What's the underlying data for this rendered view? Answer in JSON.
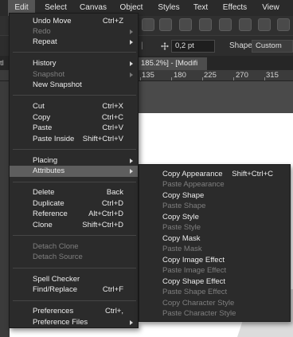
{
  "menubar": {
    "items": [
      "Edit",
      "Select",
      "Canvas",
      "Object",
      "Styles",
      "Text",
      "Effects",
      "View"
    ],
    "active": "Edit"
  },
  "propbar": {
    "stroke_value": "0,2 pt",
    "shape_label": "Shape",
    "shape_value": "Custom"
  },
  "doc_tab": {
    "left_fragment": "tl",
    "title": "185.2%] - [Modifi"
  },
  "ruler": {
    "numbers": [
      "135",
      "180",
      "225",
      "270",
      "315"
    ]
  },
  "edit_menu": {
    "items": [
      {
        "label": "Undo Move",
        "shortcut": "Ctrl+Z",
        "enabled": true
      },
      {
        "label": "Redo",
        "submenu": true,
        "enabled": false
      },
      {
        "label": "Repeat",
        "submenu": true,
        "enabled": true
      },
      {
        "label": "History",
        "submenu": true,
        "enabled": true
      },
      {
        "label": "Snapshot",
        "submenu": true,
        "enabled": false
      },
      {
        "label": "New Snapshot",
        "enabled": true
      },
      {
        "label": "Cut",
        "shortcut": "Ctrl+X",
        "enabled": true
      },
      {
        "label": "Copy",
        "shortcut": "Ctrl+C",
        "enabled": true
      },
      {
        "label": "Paste",
        "shortcut": "Ctrl+V",
        "enabled": true
      },
      {
        "label": "Paste Inside",
        "shortcut": "Shift+Ctrl+V",
        "enabled": true
      },
      {
        "label": "Placing",
        "submenu": true,
        "enabled": true
      },
      {
        "label": "Attributes",
        "submenu": true,
        "enabled": true,
        "highlighted": true
      },
      {
        "label": "Delete",
        "shortcut": "Back",
        "enabled": true
      },
      {
        "label": "Duplicate",
        "shortcut": "Ctrl+D",
        "enabled": true
      },
      {
        "label": "Reference",
        "shortcut": "Alt+Ctrl+D",
        "enabled": true
      },
      {
        "label": "Clone",
        "shortcut": "Shift+Ctrl+D",
        "enabled": true
      },
      {
        "label": "Detach Clone",
        "enabled": false
      },
      {
        "label": "Detach Source",
        "enabled": false
      },
      {
        "label": "Spell Checker",
        "enabled": true
      },
      {
        "label": "Find/Replace",
        "shortcut": "Ctrl+F",
        "enabled": true
      },
      {
        "label": "Preferences",
        "shortcut": "Ctrl+,",
        "enabled": true
      },
      {
        "label": "Preference Files",
        "submenu": true,
        "enabled": true
      }
    ]
  },
  "attributes_submenu": {
    "items": [
      {
        "label": "Copy Appearance",
        "shortcut": "Shift+Ctrl+C",
        "enabled": true
      },
      {
        "label": "Paste Appearance",
        "enabled": false
      },
      {
        "label": "Copy Shape",
        "enabled": true
      },
      {
        "label": "Paste Shape",
        "enabled": false
      },
      {
        "label": "Copy Style",
        "enabled": true
      },
      {
        "label": "Paste Style",
        "enabled": false
      },
      {
        "label": "Copy Mask",
        "enabled": true
      },
      {
        "label": "Paste Mask",
        "enabled": false
      },
      {
        "label": "Copy Image Effect",
        "enabled": true
      },
      {
        "label": "Paste Image Effect",
        "enabled": false
      },
      {
        "label": "Copy Shape Effect",
        "enabled": true
      },
      {
        "label": "Paste Shape Effect",
        "enabled": false
      },
      {
        "label": "Copy Character Style",
        "enabled": false
      },
      {
        "label": "Paste Character Style",
        "enabled": false
      }
    ]
  },
  "colors": {
    "menu_bg": "#2b2b2b",
    "highlight": "#5e5e5e",
    "disabled_text": "#7f7f7f",
    "menubar_bg": "#2a2a2a"
  }
}
